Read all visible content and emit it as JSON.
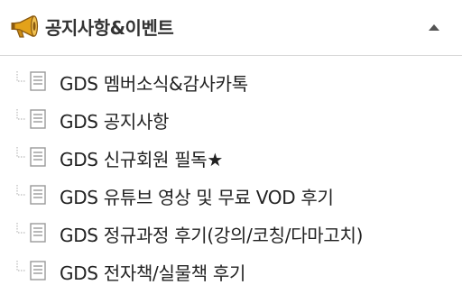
{
  "header": {
    "title": "공지사항&이벤트",
    "icon": "megaphone-icon",
    "collapse_icon": "collapse-arrow-icon"
  },
  "menu": {
    "items": [
      {
        "label": "GDS 멤버소식&감사카톡",
        "icon": "document-icon"
      },
      {
        "label": "GDS 공지사항",
        "icon": "document-icon"
      },
      {
        "label": "GDS 신규회원 필독★",
        "icon": "document-icon"
      },
      {
        "label": "GDS 유튜브 영상 및 무료 VOD 후기",
        "icon": "document-icon"
      },
      {
        "label": "GDS 정규과정 후기(강의/코칭/다마고치)",
        "icon": "document-icon"
      },
      {
        "label": "GDS 전자책/실물책 후기",
        "icon": "document-icon"
      }
    ]
  },
  "colors": {
    "megaphone_body": "#e3a21a",
    "megaphone_dark": "#8a5a12",
    "text": "#222222",
    "divider": "#d8d8d8",
    "icon_gray": "#999999"
  }
}
